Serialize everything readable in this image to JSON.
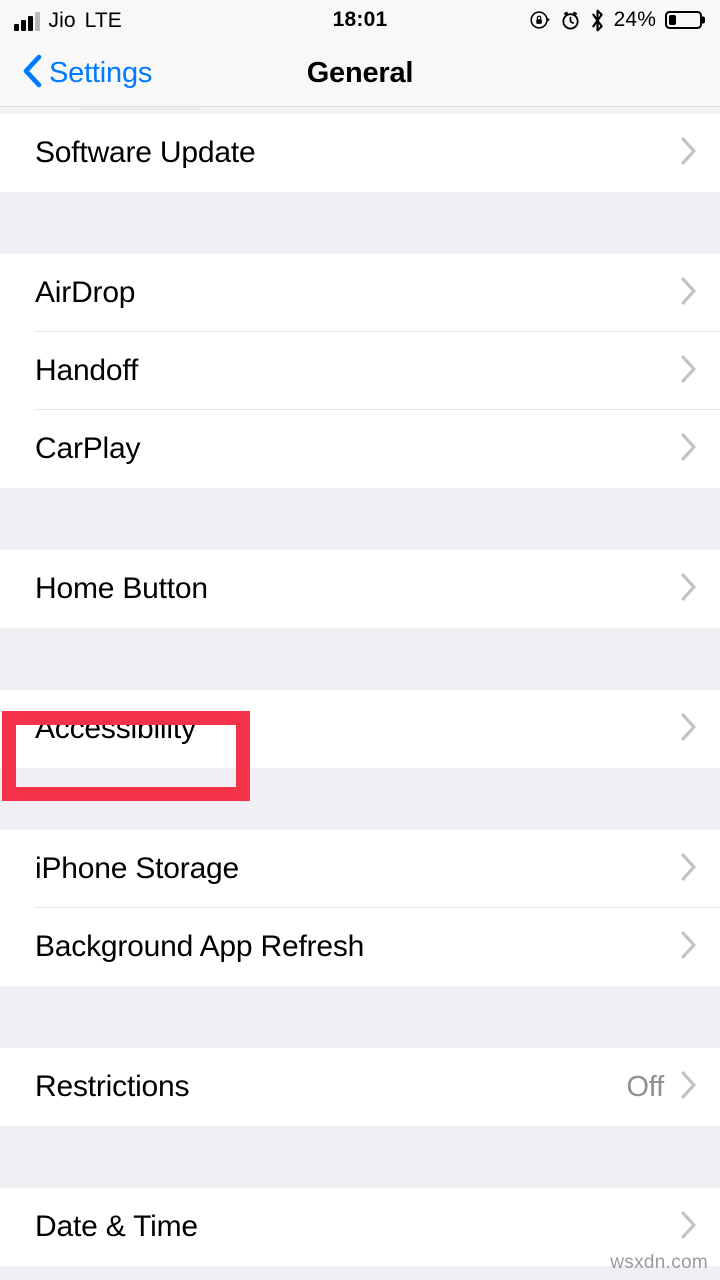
{
  "status_bar": {
    "carrier": "Jio",
    "radio": "LTE",
    "time": "18:01",
    "battery_percent": "24%",
    "battery_level": 24,
    "icons": [
      "signal-bars-icon",
      "rotation-lock-icon",
      "alarm-clock-icon",
      "bluetooth-icon",
      "battery-icon"
    ]
  },
  "nav_bar": {
    "back_label": "Settings",
    "title": "General"
  },
  "colors": {
    "accent_blue": "#007AFF",
    "highlight_red": "#F4334A",
    "group_background": "#EFEFF4",
    "row_background": "#FFFFFF",
    "secondary_text": "#8E8E93"
  },
  "list": {
    "groups": [
      {
        "rows": [
          {
            "label": "Software Update",
            "value": "",
            "accessory": "chevron-right-icon",
            "highlighted": false
          }
        ]
      },
      {
        "rows": [
          {
            "label": "AirDrop",
            "value": "",
            "accessory": "chevron-right-icon",
            "highlighted": false
          },
          {
            "label": "Handoff",
            "value": "",
            "accessory": "chevron-right-icon",
            "highlighted": false
          },
          {
            "label": "CarPlay",
            "value": "",
            "accessory": "chevron-right-icon",
            "highlighted": false
          }
        ]
      },
      {
        "rows": [
          {
            "label": "Home Button",
            "value": "",
            "accessory": "chevron-right-icon",
            "highlighted": false
          }
        ]
      },
      {
        "rows": [
          {
            "label": "Accessibility",
            "value": "",
            "accessory": "chevron-right-icon",
            "highlighted": true
          }
        ]
      },
      {
        "rows": [
          {
            "label": "iPhone Storage",
            "value": "",
            "accessory": "chevron-right-icon",
            "highlighted": false
          },
          {
            "label": "Background App Refresh",
            "value": "",
            "accessory": "chevron-right-icon",
            "highlighted": false
          }
        ]
      },
      {
        "rows": [
          {
            "label": "Restrictions",
            "value": "Off",
            "accessory": "chevron-right-icon",
            "highlighted": false
          }
        ]
      },
      {
        "rows": [
          {
            "label": "Date & Time",
            "value": "",
            "accessory": "chevron-right-icon",
            "highlighted": false
          }
        ]
      }
    ]
  },
  "watermark": {
    "text": "wsxdn.com"
  }
}
